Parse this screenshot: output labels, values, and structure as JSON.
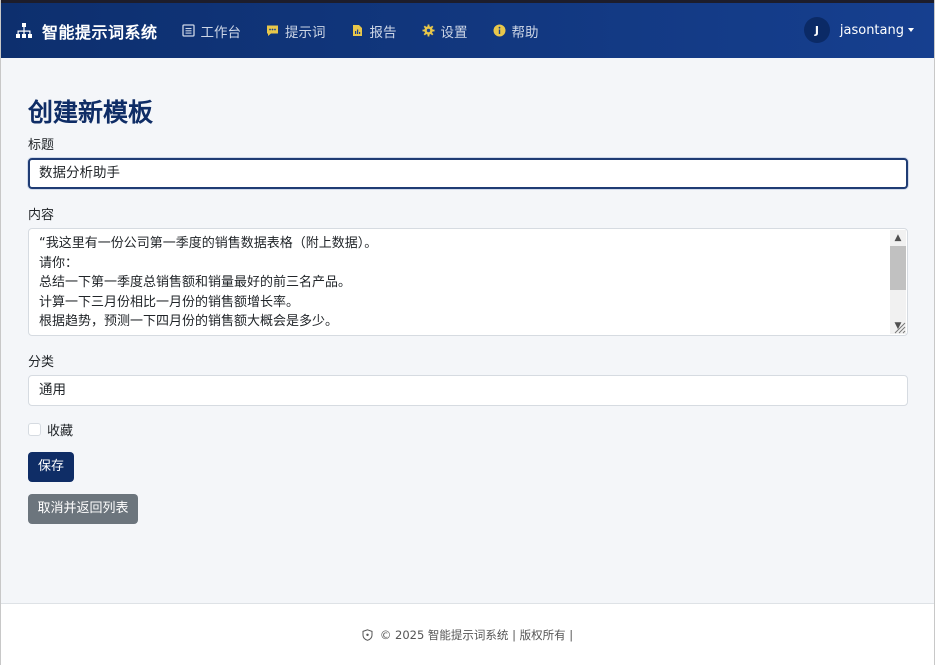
{
  "navbar": {
    "brand": "智能提示词系统",
    "items": [
      {
        "label": "工作台",
        "icon": "clipboard-icon"
      },
      {
        "label": "提示词",
        "icon": "chat-icon"
      },
      {
        "label": "报告",
        "icon": "report-icon"
      },
      {
        "label": "设置",
        "icon": "gear-icon"
      },
      {
        "label": "帮助",
        "icon": "info-icon"
      }
    ],
    "user": {
      "initial": "J",
      "name": "jasontang"
    }
  },
  "form": {
    "page_title": "创建新模板",
    "title_label": "标题",
    "title_value": "数据分析助手",
    "content_label": "内容",
    "content_lines": [
      "“我这里有一份公司第一季度的销售数据表格（附上数据）。",
      "请你：",
      "总结一下第一季度总销售额和销量最好的前三名产品。",
      "计算一下三月份相比一月份的销售额增长率。",
      "根据趋势，预测一下四月份的销售额大概会是多少。"
    ],
    "category_label": "分类",
    "category_value": "通用",
    "favorite_label": "收藏",
    "favorite_checked": false,
    "save_label": "保存",
    "cancel_label": "取消并返回列表"
  },
  "footer": {
    "text": "© 2025 智能提示词系统 | 版权所有 |"
  },
  "colors": {
    "navbar": "#0d2f6e",
    "primary": "#0f2d66",
    "secondary": "#6c757d"
  }
}
